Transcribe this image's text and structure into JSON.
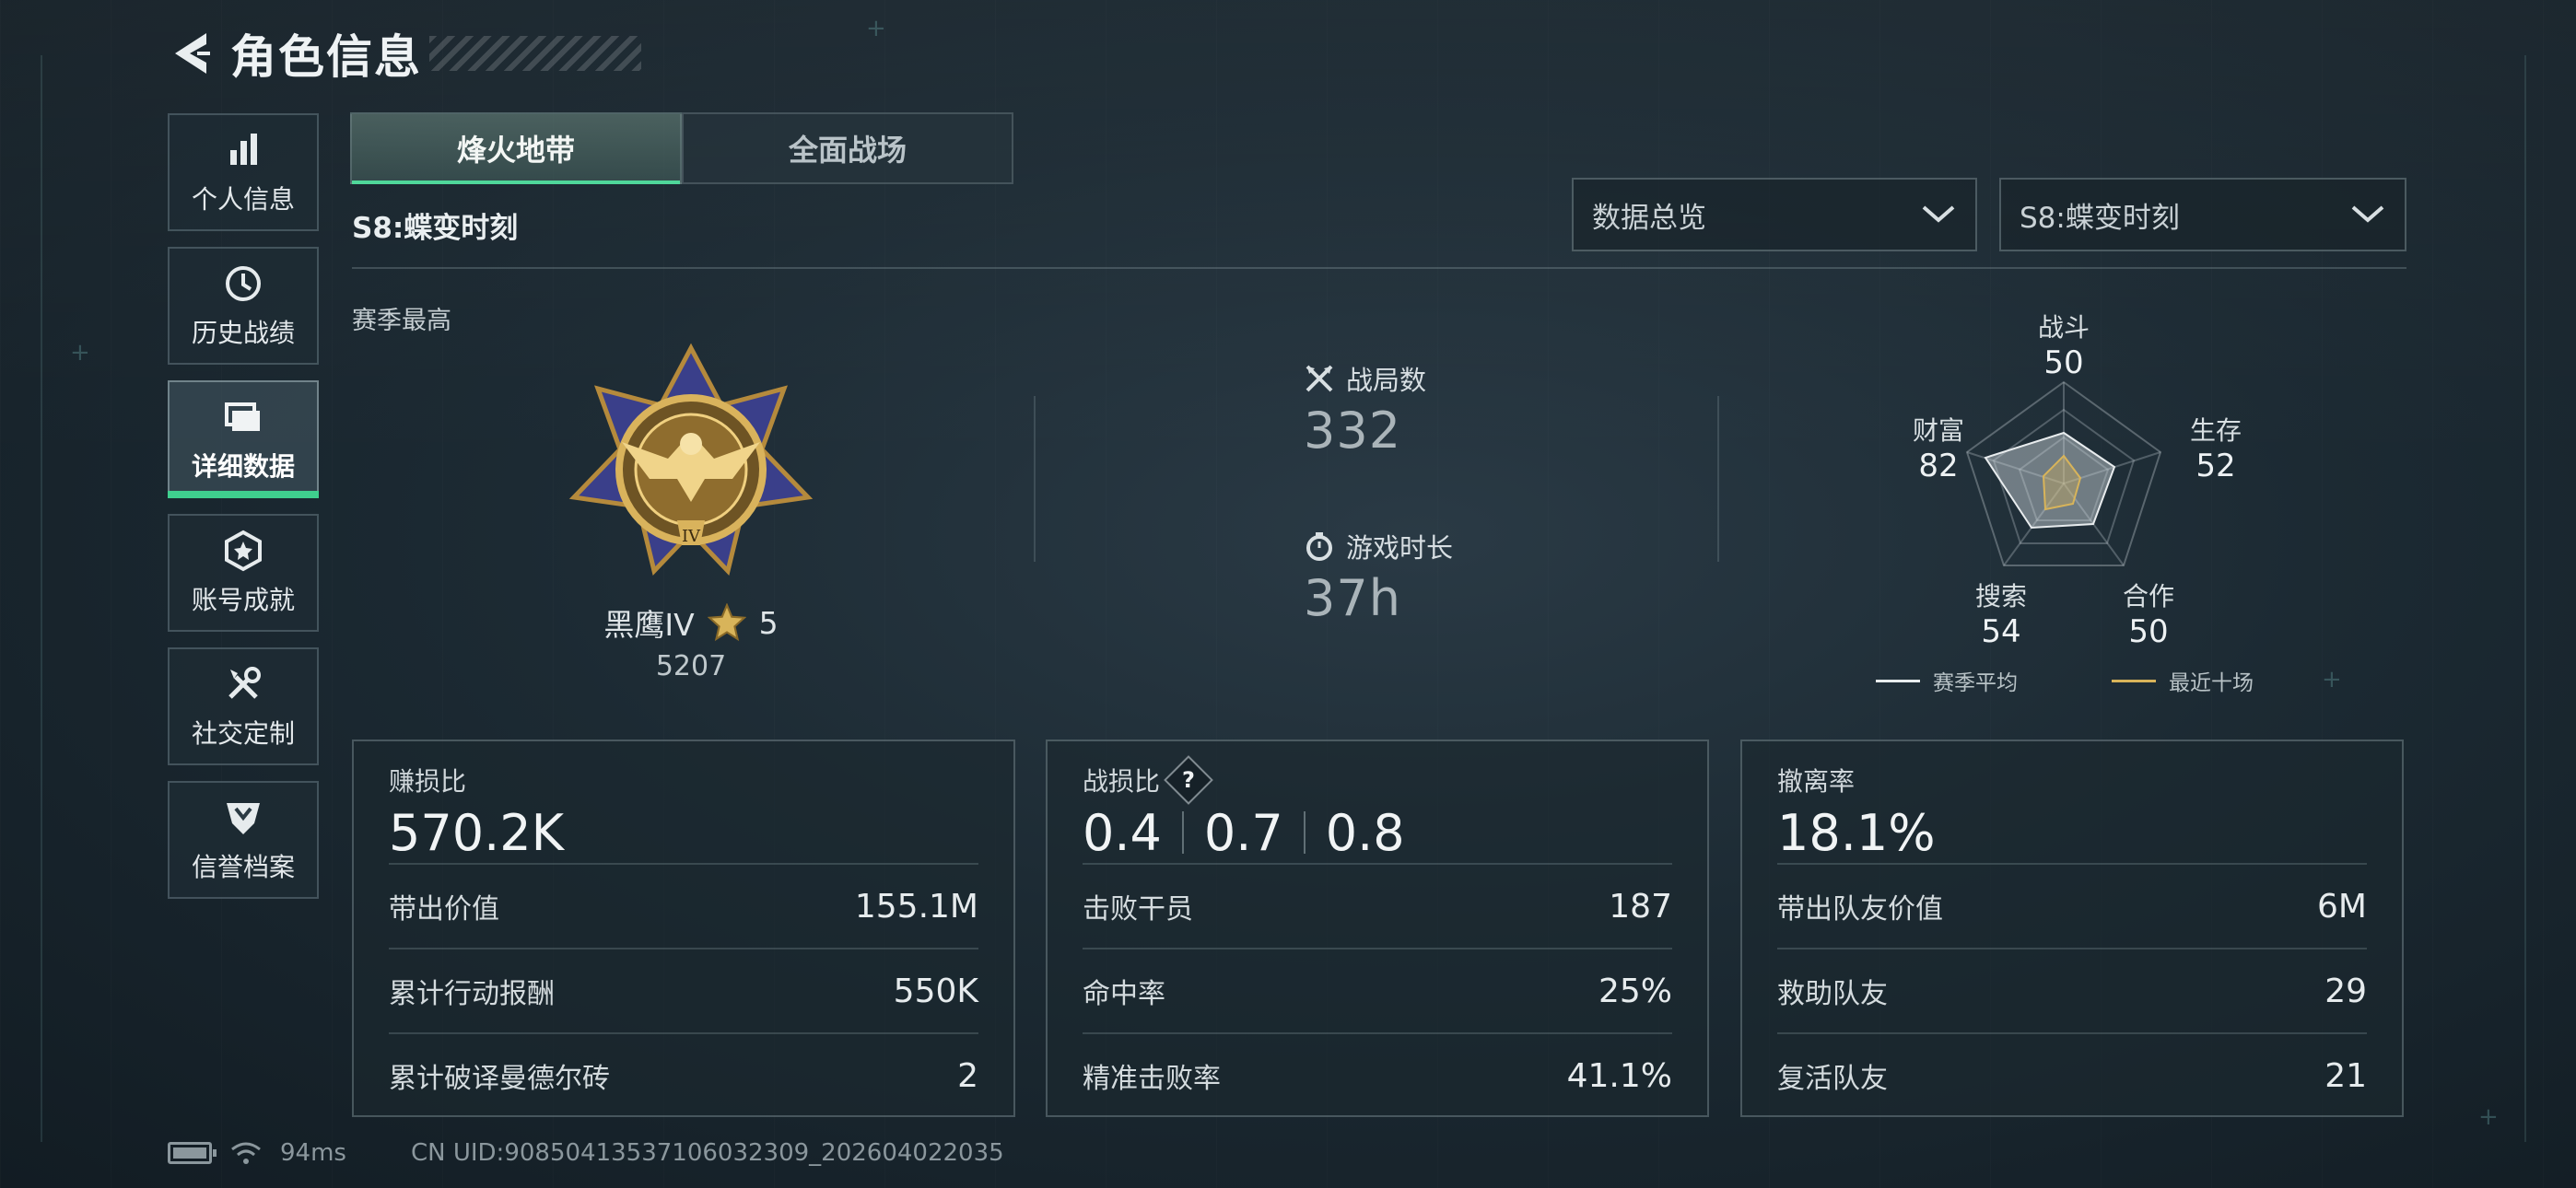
{
  "header": {
    "title": "角色信息"
  },
  "sidebar": {
    "items": [
      {
        "label": "个人信息",
        "icon": "bar-chart-icon"
      },
      {
        "label": "历史战绩",
        "icon": "history-clock-icon"
      },
      {
        "label": "详细数据",
        "icon": "folder-icon",
        "active": true
      },
      {
        "label": "账号成就",
        "icon": "achievement-badge-icon"
      },
      {
        "label": "社交定制",
        "icon": "tools-icon"
      },
      {
        "label": "信誉档案",
        "icon": "credit-shield-icon"
      }
    ]
  },
  "tabs": [
    {
      "label": "烽火地带",
      "active": true
    },
    {
      "label": "全面战场",
      "active": false
    }
  ],
  "season_title": "S8:蝶变时刻",
  "filters": {
    "overview": "数据总览",
    "season": "S8:蝶变时刻"
  },
  "season_best": {
    "label": "赛季最高",
    "rank_name": "黑鹰IV",
    "stars": "5",
    "points": "5207"
  },
  "summary": {
    "matches_label": "战局数",
    "matches_value": "332",
    "playtime_label": "游戏时长",
    "playtime_value": "37h"
  },
  "radar": {
    "axes": [
      {
        "label": "战斗",
        "value": "50"
      },
      {
        "label": "生存",
        "value": "52"
      },
      {
        "label": "合作",
        "value": "50"
      },
      {
        "label": "搜索",
        "value": "54"
      },
      {
        "label": "财富",
        "value": "82"
      }
    ],
    "legend": [
      {
        "label": "赛季平均",
        "color": "#e8ecee"
      },
      {
        "label": "最近十场",
        "color": "#d8b45a"
      }
    ]
  },
  "cards": {
    "profit": {
      "label": "赚损比",
      "value": "570.2K",
      "rows": [
        {
          "k": "带出价值",
          "v": "155.1M"
        },
        {
          "k": "累计行动报酬",
          "v": "550K"
        },
        {
          "k": "累计破译曼德尔砖",
          "v": "2"
        }
      ]
    },
    "combat": {
      "label": "战损比",
      "help": "?",
      "values": [
        "0.4",
        "0.7",
        "0.8"
      ],
      "rows": [
        {
          "k": "击败干员",
          "v": "187"
        },
        {
          "k": "命中率",
          "v": "25%"
        },
        {
          "k": "精准击败率",
          "v": "41.1%"
        }
      ]
    },
    "extract": {
      "label": "撤离率",
      "value": "18.1%",
      "rows": [
        {
          "k": "带出队友价值",
          "v": "6M"
        },
        {
          "k": "救助队友",
          "v": "29"
        },
        {
          "k": "复活队友",
          "v": "21"
        }
      ]
    }
  },
  "footer": {
    "ping": "94ms",
    "uid": "CN UID:9085041353710603230​9_202604022035"
  },
  "colors": {
    "accent": "#3fcf8e",
    "gold": "#d8b45a"
  }
}
